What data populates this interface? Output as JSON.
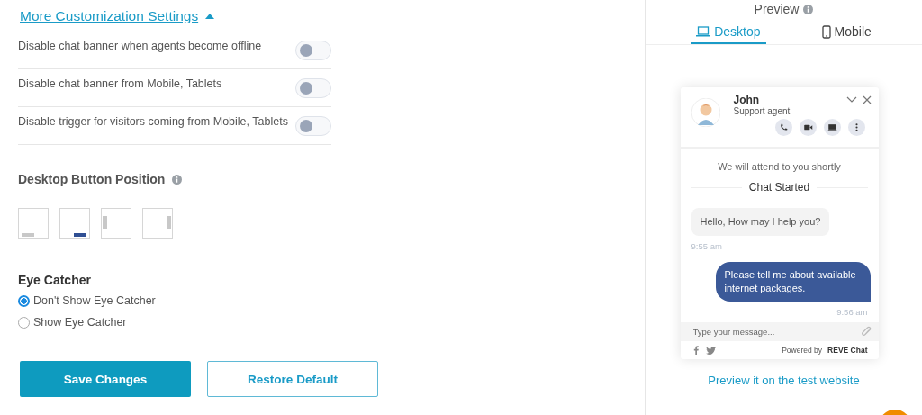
{
  "settings": {
    "title": "More Customization Settings",
    "expanded": true,
    "toggles": [
      {
        "label": "Disable chat banner when agents become offline",
        "on": false
      },
      {
        "label": "Disable chat banner from Mobile, Tablets",
        "on": false
      },
      {
        "label": "Disable trigger for visitors coming from Mobile, Tablets",
        "on": false
      }
    ]
  },
  "button_position": {
    "title": "Desktop Button Position",
    "options": [
      {
        "kind": "bottom-left",
        "selected": false
      },
      {
        "kind": "bottom-right",
        "selected": true
      },
      {
        "kind": "left",
        "selected": false
      },
      {
        "kind": "right",
        "selected": false
      }
    ]
  },
  "eye_catcher": {
    "title": "Eye Catcher",
    "options": [
      {
        "label": "Don't Show Eye Catcher",
        "selected": true
      },
      {
        "label": "Show Eye Catcher",
        "selected": false
      }
    ]
  },
  "buttons": {
    "save": "Save Changes",
    "restore": "Restore Default"
  },
  "preview": {
    "title": "Preview",
    "tabs": [
      {
        "label": "Desktop",
        "kind": "desktop",
        "selected": true
      },
      {
        "label": "Mobile",
        "kind": "mobile",
        "selected": false
      }
    ],
    "chat": {
      "agent_name": "John",
      "agent_role": "Support agent",
      "notice": "We will attend to you shortly",
      "divider": "Chat Started",
      "messages": [
        {
          "kind": "agent",
          "text": "Hello, How may I help you?",
          "time": "9:55 am"
        },
        {
          "kind": "visitor",
          "text": "Please tell me about available internet packages.",
          "time": "9:56 am"
        }
      ],
      "input_placeholder": "Type your message...",
      "powered_by": "Powered by",
      "brand": "REVE Chat"
    },
    "link": "Preview it on the test website"
  }
}
